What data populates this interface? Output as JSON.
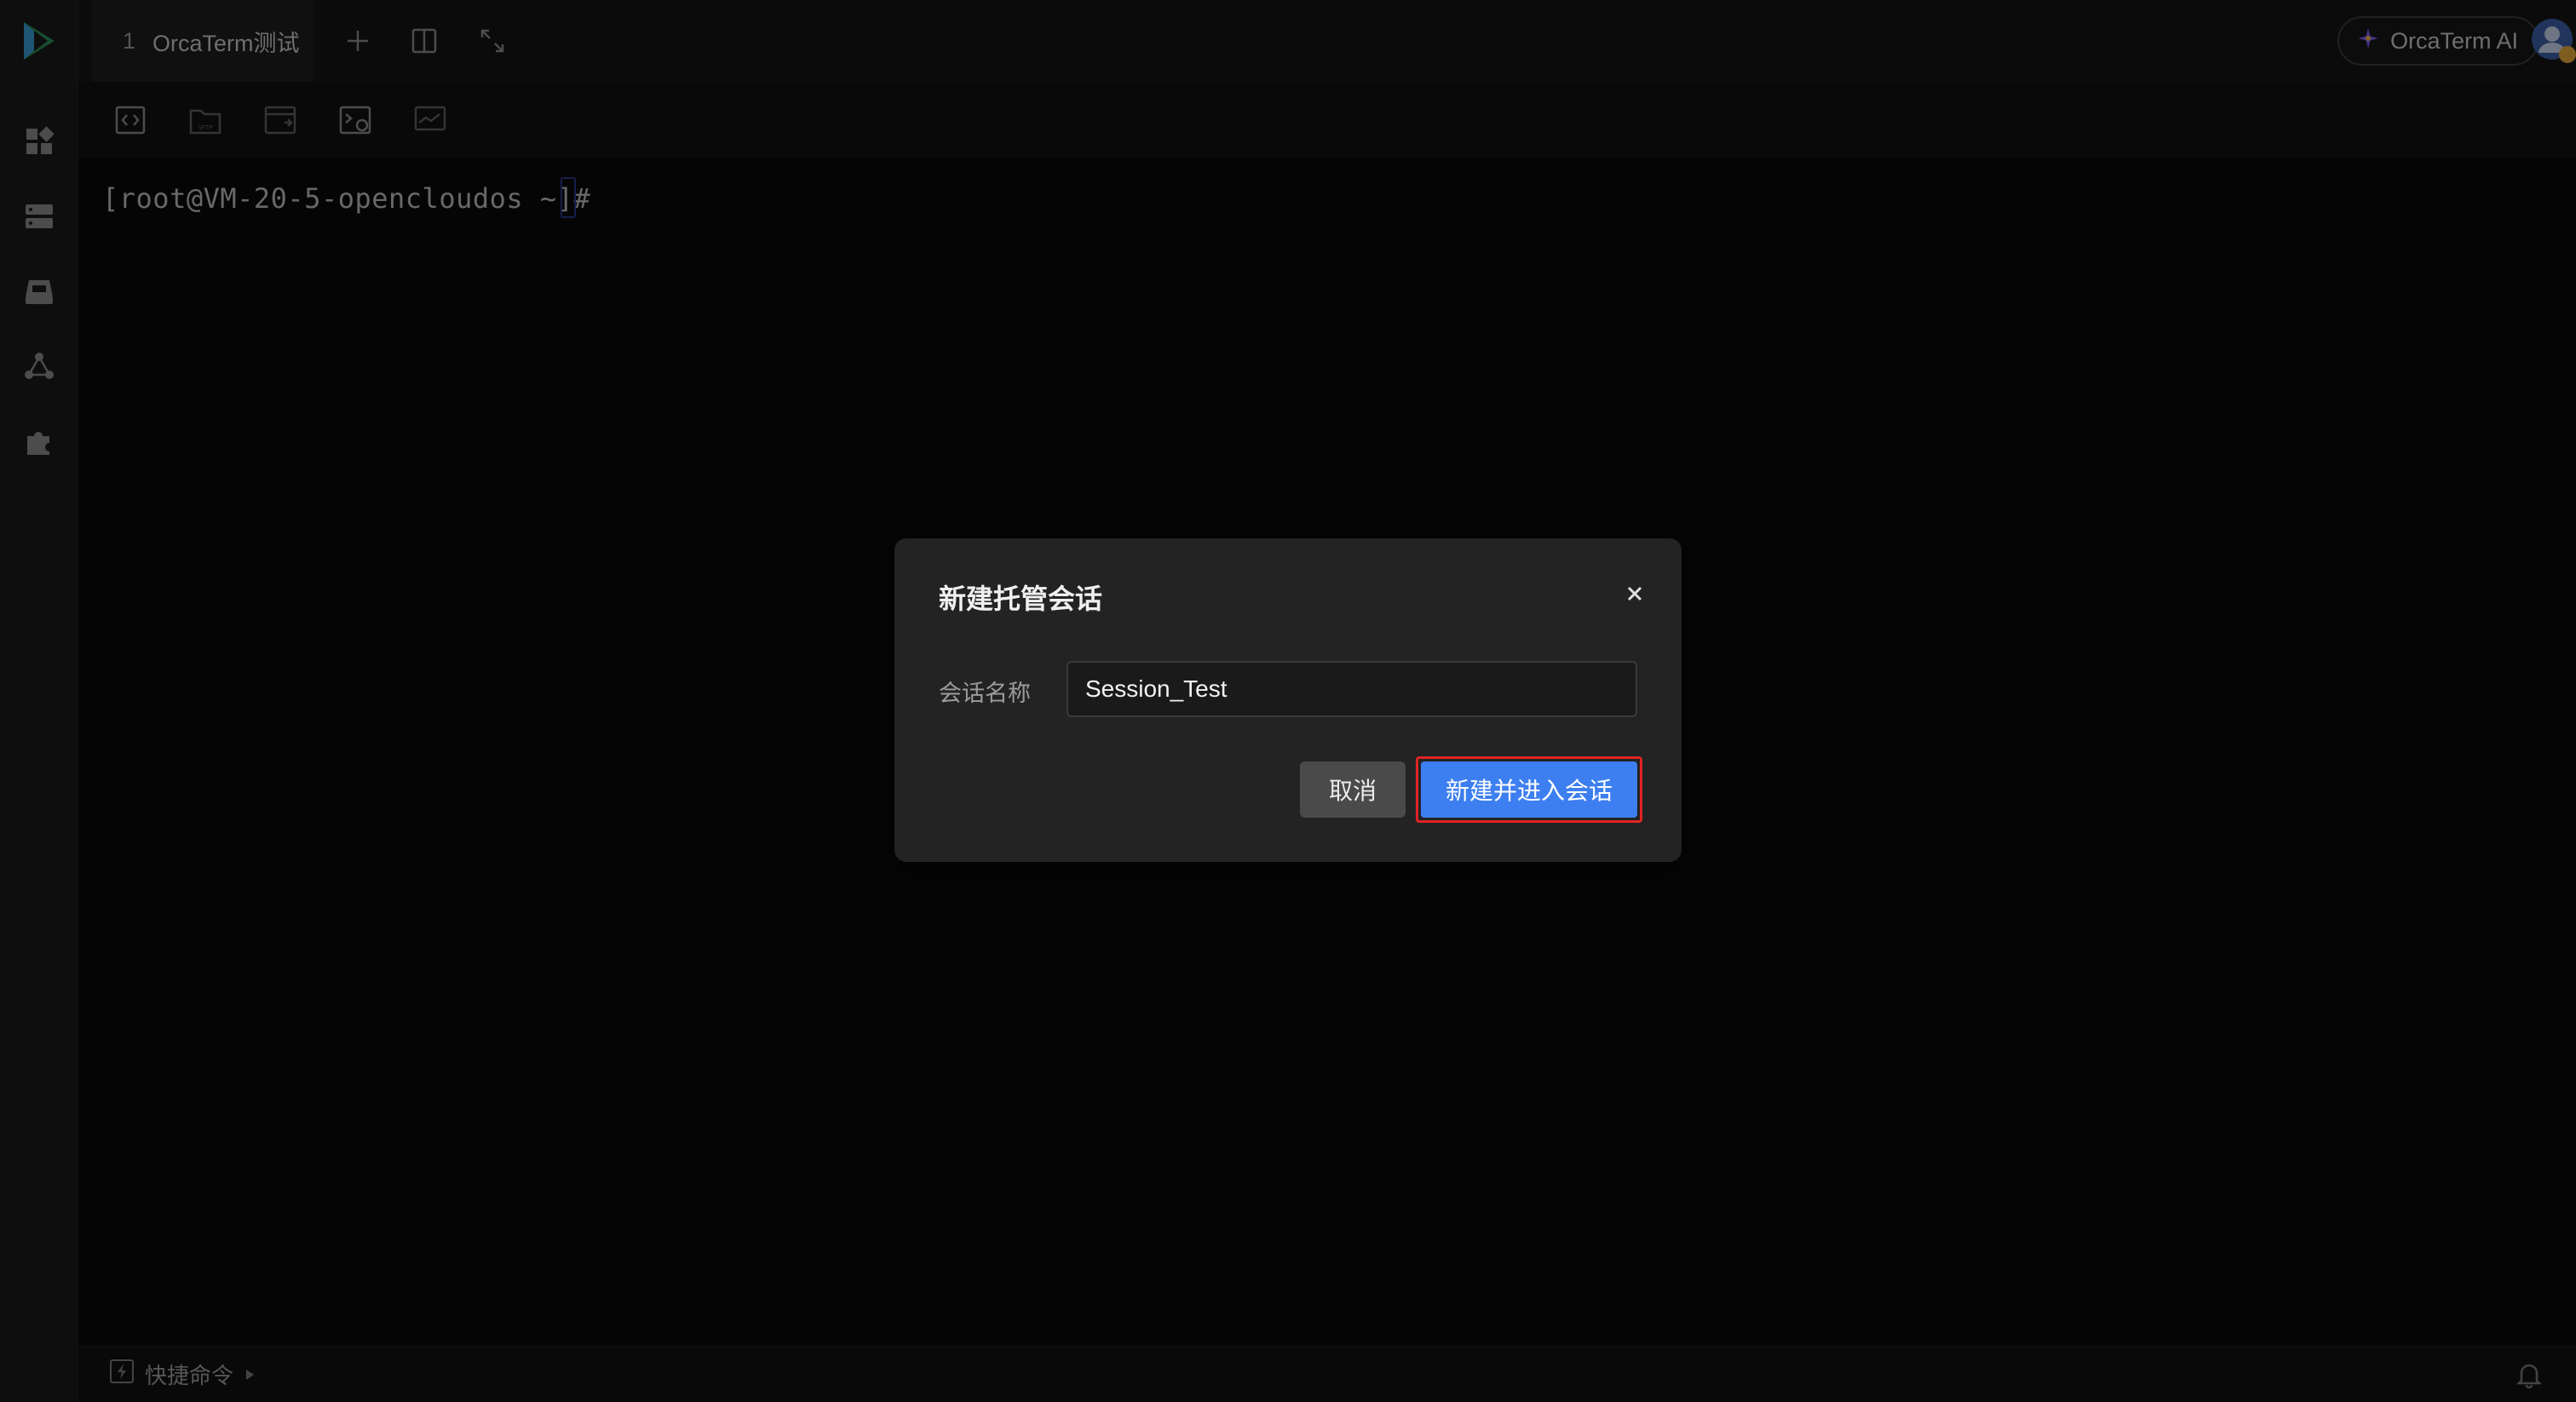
{
  "tabbar": {
    "tab": {
      "number": "1",
      "title": "OrcaTerm测试"
    },
    "ai_button_label": "OrcaTerm AI"
  },
  "terminal": {
    "prompt": "[root@VM-20-5-opencloudos ~]#"
  },
  "bottombar": {
    "quick_commands_label": "快捷命令"
  },
  "dialog": {
    "title": "新建托管会话",
    "field_label": "会话名称",
    "field_value": "Session_Test",
    "cancel_label": "取消",
    "confirm_label": "新建并进入会话"
  },
  "colors": {
    "primary": "#3d7ff0",
    "highlight_border": "#e12424",
    "dialog_bg": "#232323"
  },
  "icons": {
    "rail": [
      "logo-icon",
      "dashboard-icon",
      "servers-icon",
      "drive-icon",
      "share-icon",
      "plugin-icon"
    ],
    "toolbar": [
      "code-icon",
      "sftp-folder-icon",
      "file-transfer-icon",
      "terminal-history-icon",
      "monitor-icon"
    ],
    "tabbar": [
      "add-tab-icon",
      "split-view-icon",
      "fullscreen-icon"
    ]
  }
}
